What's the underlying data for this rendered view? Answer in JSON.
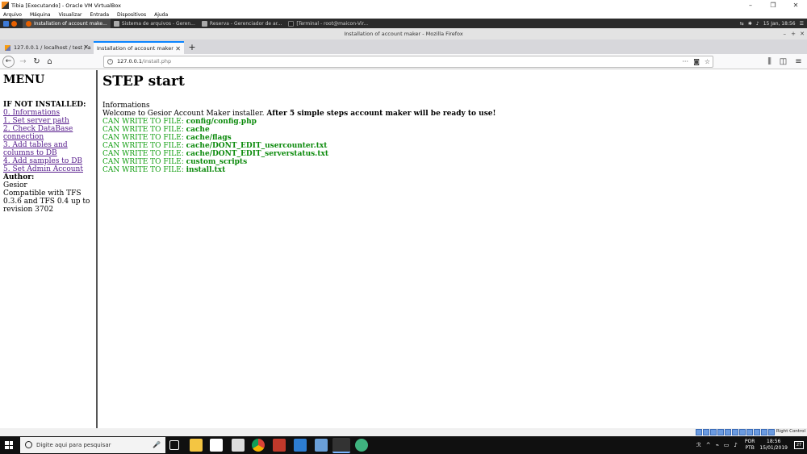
{
  "vbox": {
    "title": "Tibia [Executando] - Oracle VM VirtualBox",
    "menu": [
      "Arquivo",
      "Máquina",
      "Visualizar",
      "Entrada",
      "Dispositivos",
      "Ajuda"
    ],
    "host_key": "Right Control"
  },
  "guest_panel": {
    "tasks": [
      {
        "label": "Installation of account make..."
      },
      {
        "label": "Sistema de arquivos - Geren..."
      },
      {
        "label": "Reserva - Gerenciador de ar..."
      },
      {
        "label": "[Terminal - root@maicon-Vir..."
      }
    ],
    "date": "15 Jan, 18:56"
  },
  "firefox": {
    "window_title": "Installation of account maker - Mozilla Firefox",
    "tabs": [
      {
        "label": "127.0.0.1 / localhost / test / a"
      },
      {
        "label": "Installation of account maker"
      }
    ],
    "url_host": "127.0.0.1",
    "url_path": "/install.php"
  },
  "menu": {
    "title": "MENU",
    "section": "IF NOT INSTALLED:",
    "links": [
      "0. Informations",
      "1. Set server path",
      "2. Check DataBase connection",
      "3. Add tables and columns to DB",
      "4. Add samples to DB",
      "5. Set Admin Account"
    ],
    "author_label": "Author:",
    "author": "Gesior",
    "compat": "Compatible with TFS 0.3.6 and TFS 0.4 up to revision 3702"
  },
  "main": {
    "heading": "STEP start",
    "info_label": "Informations",
    "welcome": "Welcome to Gesior Account Maker installer.",
    "welcome_bold": "After 5 simple steps account maker will be ready to use!",
    "can_write_prefix": "CAN WRITE TO FILE:",
    "files": [
      "config/config.php",
      "cache",
      "cache/flags",
      "cache/DONT_EDIT_usercounter.txt",
      "cache/DONT_EDIT_serverstatus.txt",
      "custom_scripts",
      "install.txt"
    ]
  },
  "taskbar": {
    "search_placeholder": "Digite aqui para pesquisar",
    "lang_top": "POR",
    "lang_bottom": "PTB",
    "time": "18:56",
    "date": "15/01/2019",
    "notifications": "27"
  }
}
